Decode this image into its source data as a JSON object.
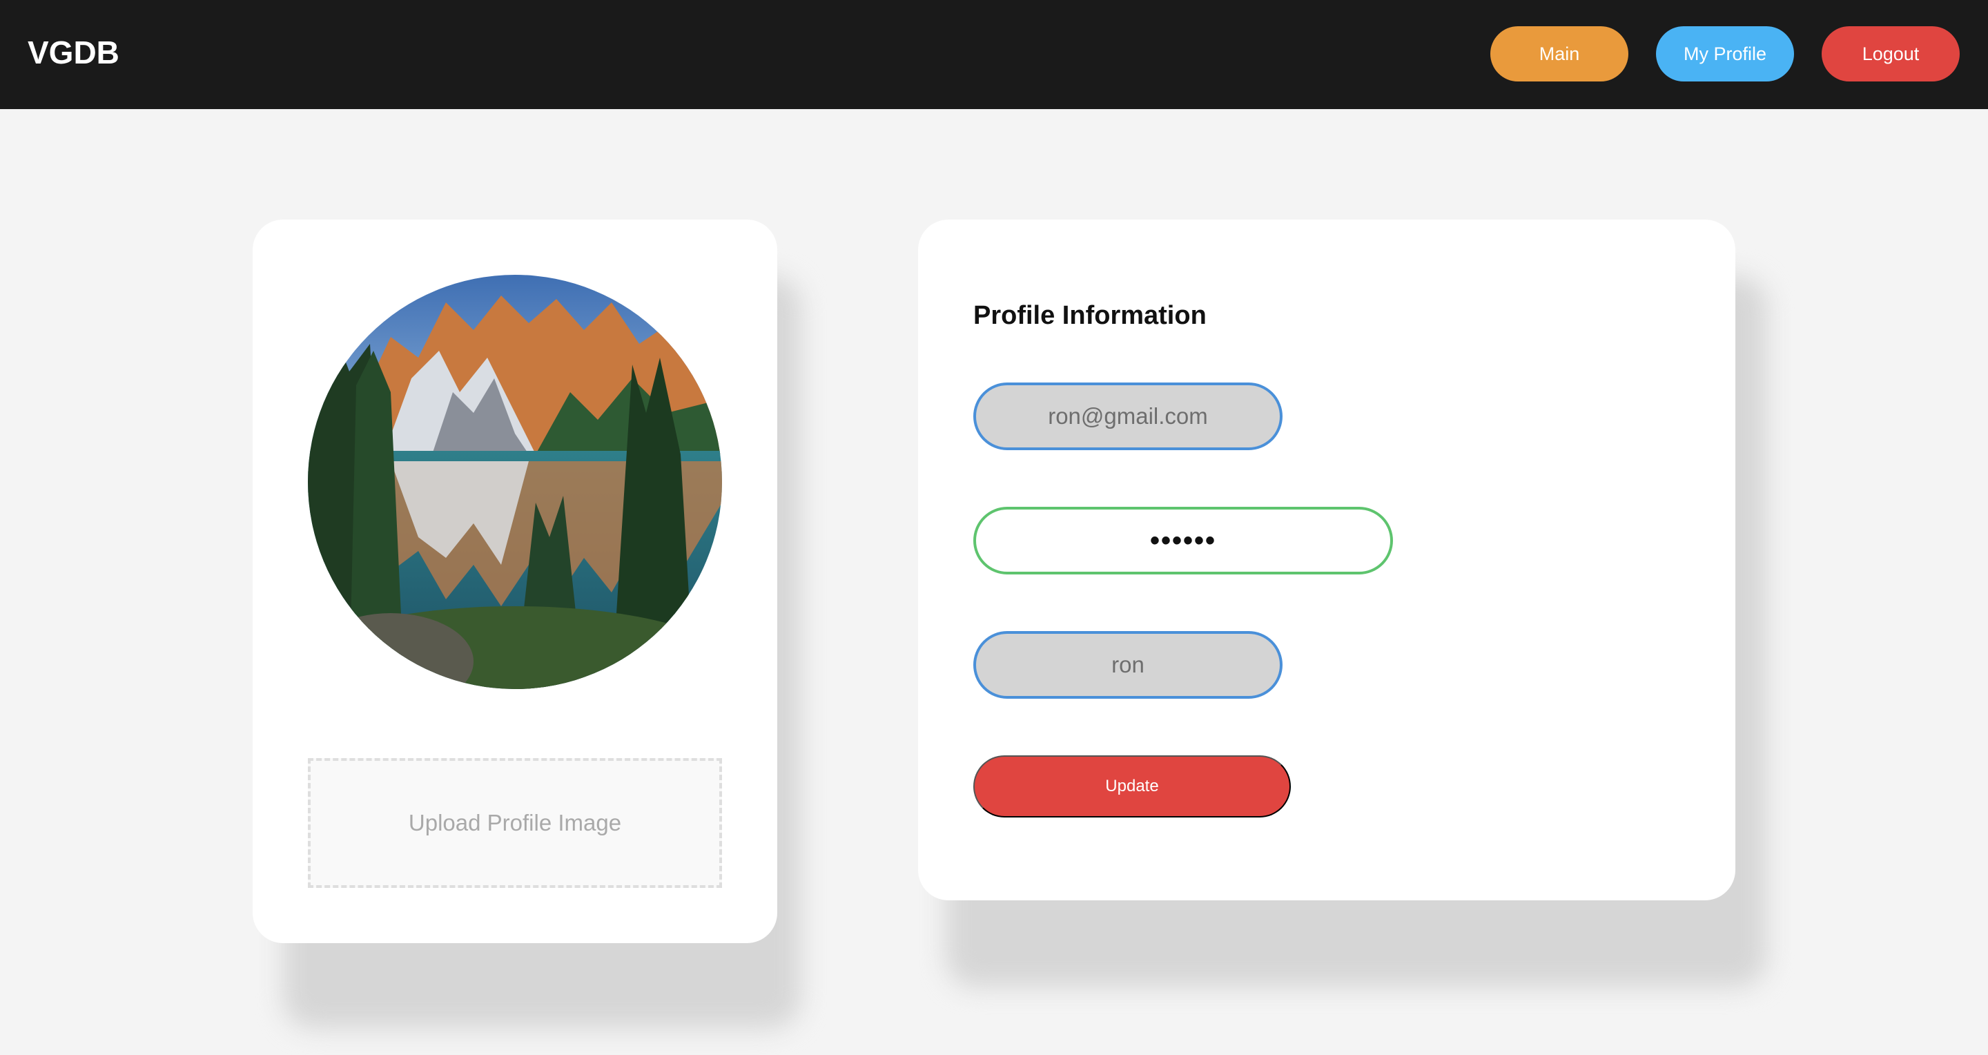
{
  "header": {
    "brand": "VGDB",
    "nav": {
      "main_label": "Main",
      "profile_label": "My Profile",
      "logout_label": "Logout"
    },
    "colors": {
      "background": "#1a1a1a",
      "main": "#e99a3c",
      "profile": "#4ab3f4",
      "logout": "#e04540"
    }
  },
  "profile_image": {
    "icon": "mountain-lake-photo",
    "upload_label": "Upload Profile Image"
  },
  "profile_form": {
    "title": "Profile Information",
    "email_value": "ron@gmail.com",
    "password_value": "••••••",
    "username_value": "ron",
    "update_label": "Update",
    "colors": {
      "readonly_border": "#4a90d9",
      "active_border": "#5ec46e",
      "update": "#e04540"
    }
  }
}
